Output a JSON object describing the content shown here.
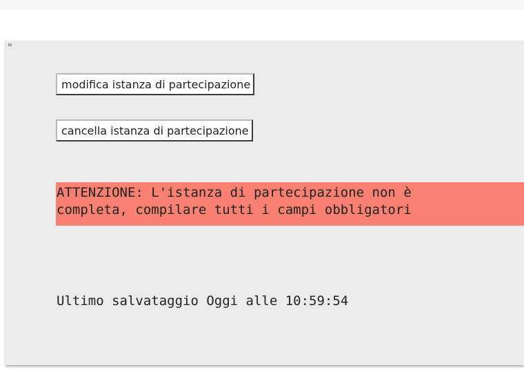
{
  "panel": {
    "quote_mark": "\"",
    "buttons": {
      "modifica_label": "modifica istanza di partecipazione",
      "cancella_label": "cancella istanza di partecipazione"
    },
    "alert": {
      "line1": "ATTENZIONE: L'istanza di partecipazione non è",
      "line2": "completa, compilare tutti i campi obbligatori"
    },
    "last_save": "Ultimo salvataggio Oggi alle 10:59:54"
  },
  "colors": {
    "panel_bg": "#ebebeb",
    "alert_bg": "#fa8072",
    "text": "#222222"
  }
}
